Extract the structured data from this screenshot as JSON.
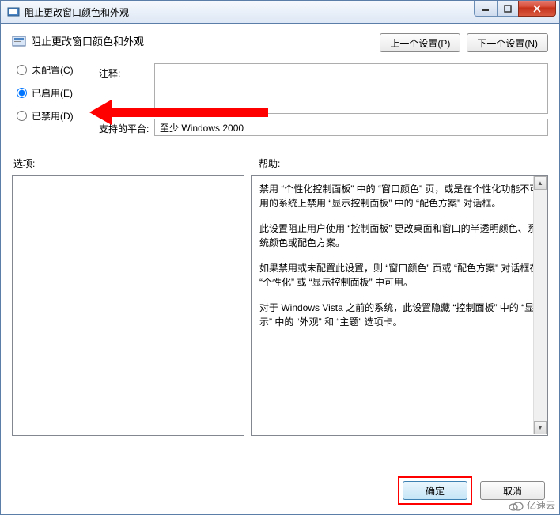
{
  "titlebar": {
    "title": "阻止更改窗口颜色和外观"
  },
  "header": {
    "title": "阻止更改窗口颜色和外观",
    "prev_label": "上一个设置(P)",
    "next_label": "下一个设置(N)",
    "prev_key": "P",
    "next_key": "N"
  },
  "radios": {
    "not_configured": "未配置(C)",
    "enabled": "已启用(E)",
    "disabled": "已禁用(D)",
    "selected": "enabled"
  },
  "config": {
    "comment_label": "注释:",
    "comment_value": "",
    "platform_label": "支持的平台:",
    "platform_value": "至少 Windows 2000"
  },
  "sections": {
    "options_label": "选项:",
    "help_label": "帮助:"
  },
  "help": {
    "p1": "禁用 “个性化控制面板” 中的 “窗口颜色” 页，或是在个性化功能不可用的系统上禁用 “显示控制面板” 中的 “配色方案” 对话框。",
    "p2": "此设置阻止用户使用 “控制面板” 更改桌面和窗口的半透明颜色、系统颜色或配色方案。",
    "p3": "如果禁用或未配置此设置，则 “窗口颜色” 页或 “配色方案” 对话框在 “个性化” 或 “显示控制面板” 中可用。",
    "p4": "对于 Windows Vista 之前的系统，此设置隐藏 “控制面板” 中的 “显示” 中的 “外观” 和 “主题” 选项卡。"
  },
  "footer": {
    "ok": "确定",
    "cancel": "取消"
  },
  "watermark": "亿速云"
}
